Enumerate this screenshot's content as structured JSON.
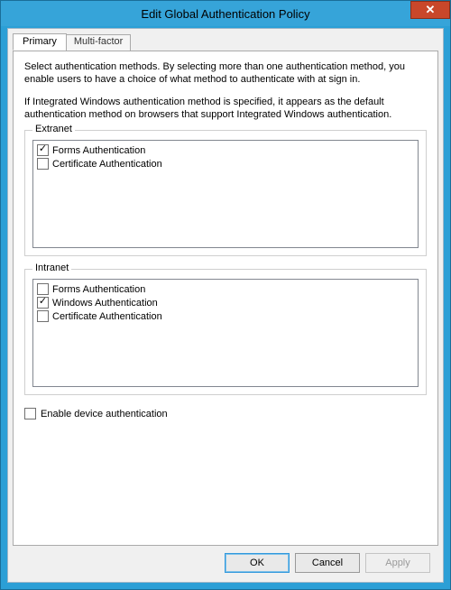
{
  "window": {
    "title": "Edit Global Authentication Policy"
  },
  "tabs": {
    "primary": "Primary",
    "multifactor": "Multi-factor"
  },
  "primaryPanel": {
    "intro1": "Select authentication methods. By selecting more than one authentication method, you enable users to have a choice of what method to authenticate with at sign in.",
    "intro2": "If Integrated Windows authentication method is specified, it appears as the default authentication method on browsers that support Integrated Windows authentication.",
    "extranet": {
      "legend": "Extranet",
      "items": [
        {
          "label": "Forms Authentication",
          "checked": true
        },
        {
          "label": "Certificate Authentication",
          "checked": false
        }
      ]
    },
    "intranet": {
      "legend": "Intranet",
      "items": [
        {
          "label": "Forms Authentication",
          "checked": false
        },
        {
          "label": "Windows Authentication",
          "checked": true
        },
        {
          "label": "Certificate Authentication",
          "checked": false
        }
      ]
    },
    "enableDevice": {
      "label": "Enable device authentication",
      "checked": false
    }
  },
  "buttons": {
    "ok": "OK",
    "cancel": "Cancel",
    "apply": "Apply"
  }
}
